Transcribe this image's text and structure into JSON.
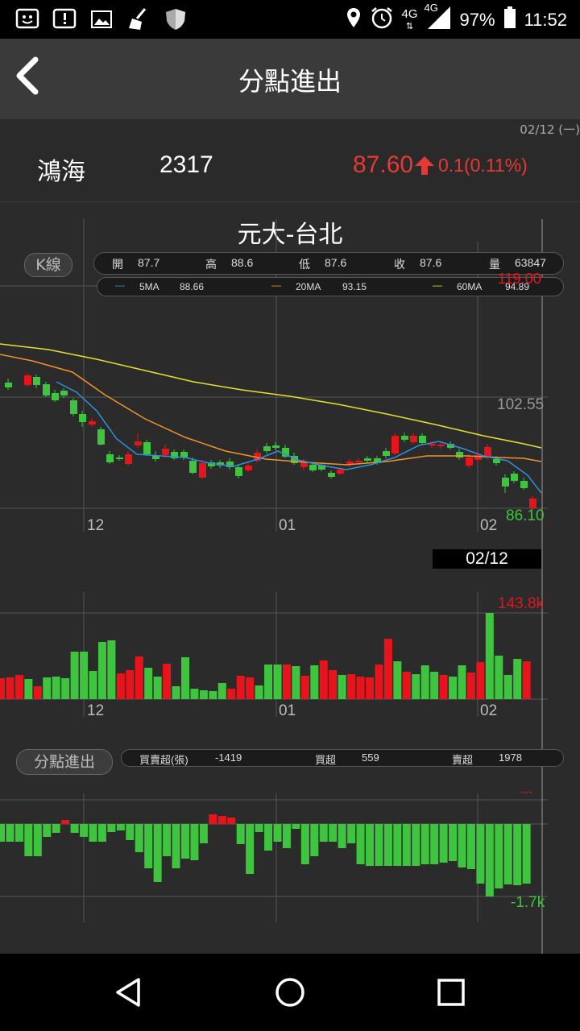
{
  "status": {
    "battery": "97%",
    "time": "11:52",
    "net1": "4G",
    "net2": "4G"
  },
  "header": {
    "title": "分點進出"
  },
  "date": "02/12 (一)",
  "stock": {
    "name": "鴻海",
    "code": "2317",
    "price": "87.60",
    "change": "0.1(0.11%)"
  },
  "broker": "元大-台北",
  "kline": {
    "button": "K線",
    "ohlc": {
      "open_label": "開",
      "open": "87.7",
      "high_label": "高",
      "high": "88.6",
      "low_label": "低",
      "low": "87.6",
      "close_label": "收",
      "close": "87.6",
      "vol_label": "量",
      "vol": "63847"
    },
    "ma": {
      "ma5_label": "5MA",
      "ma5": "88.66",
      "ma20_label": "20MA",
      "ma20": "93.15",
      "ma60_label": "60MA",
      "ma60": "94.89"
    },
    "price_max": "119.00",
    "price_mid": "102.55",
    "price_min": "86.10",
    "x_labels": [
      "12",
      "01",
      "02"
    ],
    "cursor_date": "02/12"
  },
  "volume": {
    "max": "143.8k",
    "x_labels": [
      "12",
      "01",
      "02"
    ]
  },
  "flow": {
    "button": "分點進出",
    "net_label": "買賣超(張)",
    "net": "-1419",
    "buy_label": "買超",
    "buy": "559",
    "sell_label": "賣超",
    "sell": "1978",
    "min": "-1.7k",
    "max": "---"
  },
  "colors": {
    "up": "#e8141b",
    "down": "#3ec43e",
    "ma5": "#2f8fe0",
    "ma20": "#f0932a",
    "ma60": "#e8e030",
    "bg": "#2b2b2b"
  },
  "chart_data": {
    "type": "bar",
    "title": "元大-台北",
    "x": [
      "12",
      "01",
      "02"
    ],
    "price_range": [
      86.1,
      119.0
    ],
    "volume_max": "143.8k",
    "flow_min": "-1.7k"
  }
}
